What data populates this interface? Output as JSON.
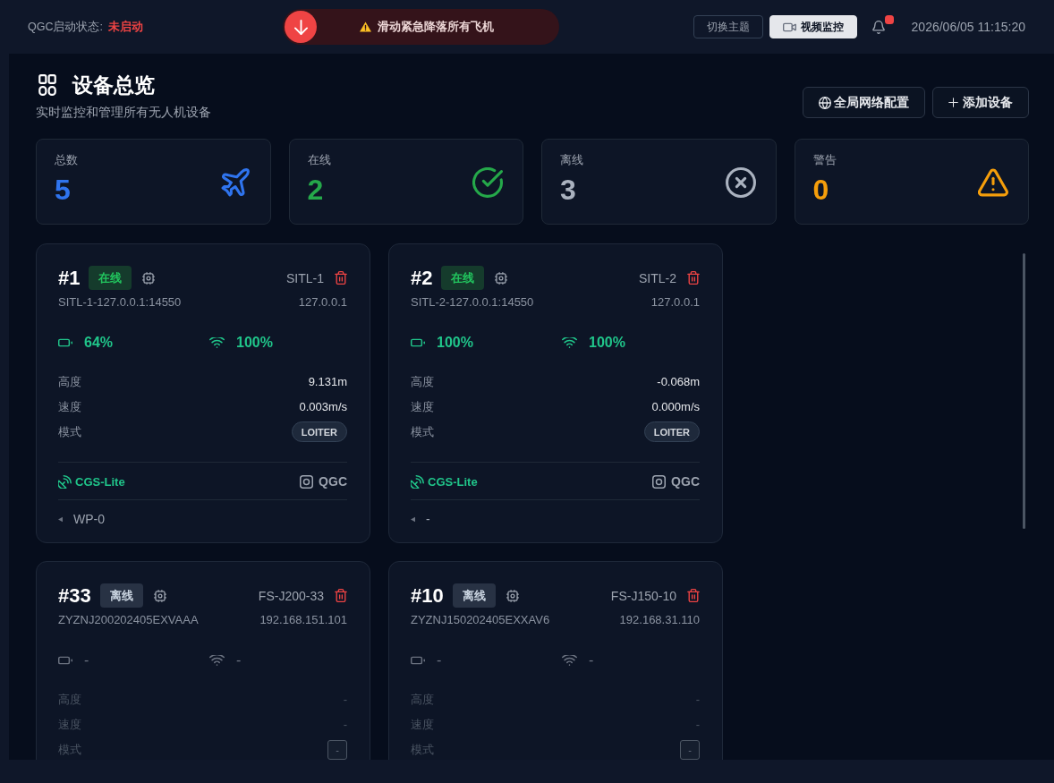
{
  "top_bar": {
    "qgc_status_label": "QGC启动状态:",
    "qgc_status": "未启动",
    "qgc_running": false,
    "emergency_slider": {
      "text": "滑动紧急降落所有飞机",
      "level": 0
    },
    "buttons": [
      {
        "label": "切换主题",
        "kind": "theme",
        "on": false
      },
      {
        "label": "视频监控",
        "kind": "video",
        "on": true
      }
    ],
    "notifications": {
      "unread": true
    },
    "datetime": "2026/06/05 11:15:20"
  },
  "header": {
    "title": "设备总览",
    "subtitle": "实时监控和管理所有无人机设备",
    "buttons": [
      {
        "label": "全局网络配置",
        "kind": "globe"
      },
      {
        "label": "添加设备",
        "kind": "add"
      }
    ]
  },
  "stats": [
    {
      "label": "总数",
      "value": "5",
      "kind": "total",
      "color": "#2f74ee"
    },
    {
      "label": "在线",
      "value": "2",
      "kind": "online",
      "color": "#25a84a"
    },
    {
      "label": "离线",
      "value": "3",
      "kind": "offline",
      "color": "#aab2bf"
    },
    {
      "label": "警告",
      "value": "0",
      "kind": "warning",
      "color": "#f59e0b"
    }
  ],
  "devices": [
    {
      "number": "#1",
      "status": "在线",
      "online": true,
      "name": "SITL-1",
      "connection": "SITL-1-127.0.0.1:14550",
      "ip": "127.0.0.1",
      "battery": "64%",
      "signal": "100%",
      "telemetry": [
        {
          "label": "高度",
          "value": "9.131m",
          "kind": "text"
        },
        {
          "label": "速度",
          "value": "0.003m/s",
          "kind": "text"
        },
        {
          "label": "模式",
          "value": "LOITER",
          "kind": "mode"
        }
      ],
      "ground_station": "CGS-Lite",
      "autopilot": "QGC",
      "waypoint": "WP-0"
    },
    {
      "number": "#2",
      "status": "在线",
      "online": true,
      "name": "SITL-2",
      "connection": "SITL-2-127.0.0.1:14550",
      "ip": "127.0.0.1",
      "battery": "100%",
      "signal": "100%",
      "telemetry": [
        {
          "label": "高度",
          "value": "-0.068m",
          "kind": "text"
        },
        {
          "label": "速度",
          "value": "0.000m/s",
          "kind": "text"
        },
        {
          "label": "模式",
          "value": "LOITER",
          "kind": "mode"
        }
      ],
      "ground_station": "CGS-Lite",
      "autopilot": "QGC",
      "waypoint": "-"
    },
    {
      "number": "#33",
      "status": "离线",
      "online": false,
      "name": "FS-J200-33",
      "connection": "ZYZNJ200202405EXVAAA",
      "ip": "192.168.151.101",
      "battery": "-",
      "signal": "-",
      "telemetry": [
        {
          "label": "高度",
          "value": "-",
          "kind": "text"
        },
        {
          "label": "速度",
          "value": "-",
          "kind": "text"
        },
        {
          "label": "模式",
          "value": "-",
          "kind": "mode"
        }
      ]
    },
    {
      "number": "#10",
      "status": "离线",
      "online": false,
      "name": "FS-J150-10",
      "connection": "ZYZNJ150202405EXXAV6",
      "ip": "192.168.31.110",
      "battery": "-",
      "signal": "-",
      "telemetry": [
        {
          "label": "高度",
          "value": "-",
          "kind": "text"
        },
        {
          "label": "速度",
          "value": "-",
          "kind": "text"
        },
        {
          "label": "模式",
          "value": "-",
          "kind": "mode"
        }
      ]
    }
  ]
}
